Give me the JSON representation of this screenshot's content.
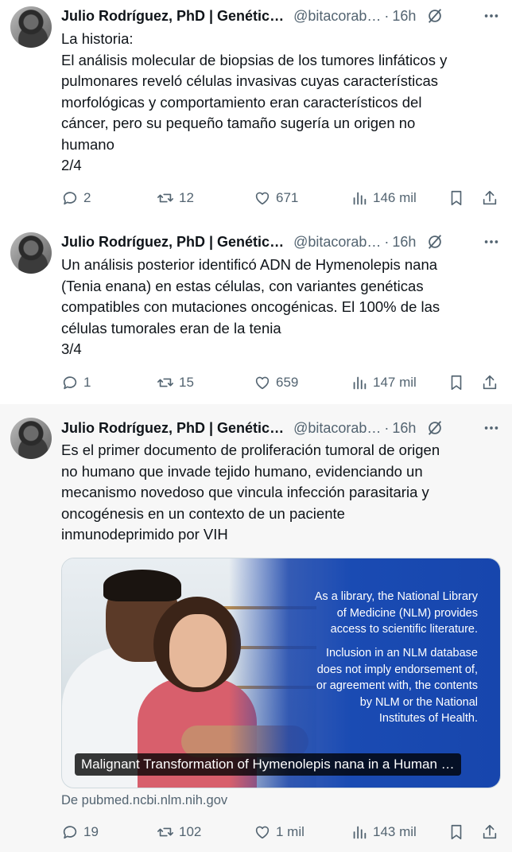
{
  "tweets": [
    {
      "author": "Julio Rodríguez, PhD | Genétic…",
      "handle": "@bitacorab…",
      "dot": "·",
      "time": "16h",
      "lines": [
        "La historia:",
        "El análisis molecular de biopsias de los tumores linfáticos y",
        "pulmonares reveló células invasivas cuyas características",
        "morfológicas y comportamiento eran característicos del",
        "cáncer, pero su pequeño tamaño sugería un origen no",
        "humano",
        "2/4"
      ],
      "replies": "2",
      "reposts": "12",
      "likes": "671",
      "views": "146 mil"
    },
    {
      "author": "Julio Rodríguez, PhD | Genétic…",
      "handle": "@bitacorab…",
      "dot": "·",
      "time": "16h",
      "lines": [
        "Un análisis posterior identificó ADN de Hymenolepis nana",
        "(Tenia enana) en estas células, con variantes genéticas",
        "compatibles con mutaciones oncogénicas. El 100% de las",
        "células tumorales eran de la tenia",
        "3/4"
      ],
      "replies": "1",
      "reposts": "15",
      "likes": "659",
      "views": "147 mil"
    },
    {
      "author": "Julio Rodríguez, PhD | Genétic…",
      "handle": "@bitacorab…",
      "dot": "·",
      "time": "16h",
      "lines": [
        "Es el primer documento de proliferación tumoral de origen",
        "no humano que invade tejido humano, evidenciando un",
        "mecanismo novedoso que vincula infección parasitaria y",
        "oncogénesis en un contexto de un paciente",
        "inmunodeprimido por VIH"
      ],
      "card": {
        "notice_lines": [
          "As a library, the National Library",
          "of Medicine (NLM) provides",
          "access to scientific literature.",
          "",
          "Inclusion in an NLM database",
          "does not imply endorsement of,",
          "or agreement with, the contents",
          "by NLM or the National",
          "Institutes of Health."
        ],
        "caption": "Malignant Transformation of Hymenolepis nana in a Human …",
        "source": "De pubmed.ncbi.nlm.nih.gov"
      },
      "replies": "19",
      "reposts": "102",
      "likes": "1 mil",
      "views": "143 mil"
    }
  ],
  "colors": {
    "text": "#0f1419",
    "muted": "#536471",
    "thread_line": "#cfd9de",
    "card_blue": "#1a4bb3",
    "highlight_bg": "#f7f7f7"
  },
  "icons": {
    "reply": "speech-bubble-icon",
    "repost": "repost-arrows-icon",
    "like": "heart-icon",
    "views": "bar-chart-icon",
    "bookmark": "bookmark-icon",
    "share": "share-upload-icon",
    "grok": "grok-slash-circle-icon",
    "more": "ellipsis-icon"
  }
}
